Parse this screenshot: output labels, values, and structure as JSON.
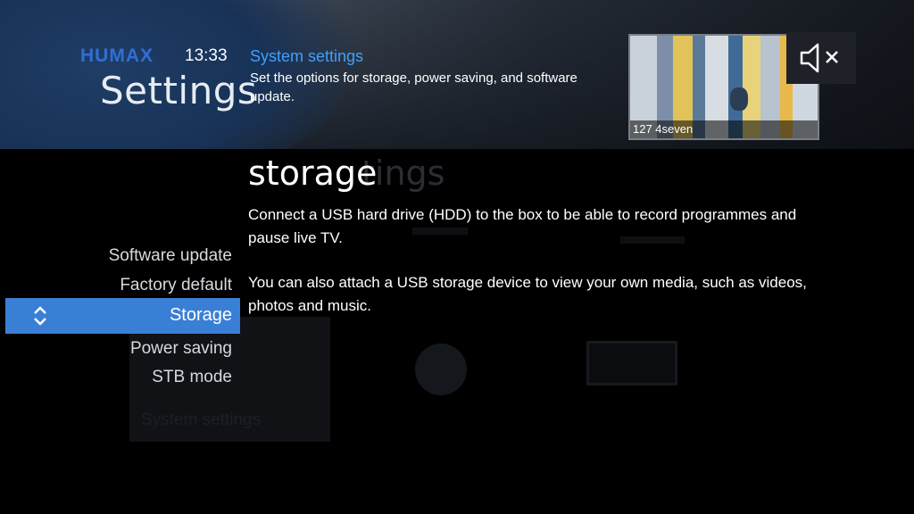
{
  "header": {
    "brand": "HUMAX",
    "time": "13:33",
    "page_title": "Settings",
    "section_title": "System settings",
    "section_description": "Set the options for storage, power saving, and software update."
  },
  "preview": {
    "channel_caption": "127 4seven"
  },
  "mute": {
    "icon": "speaker-muted-icon"
  },
  "menu": {
    "items": [
      {
        "label": "Software update",
        "selected": false
      },
      {
        "label": "Factory default",
        "selected": false
      },
      {
        "label": "Storage",
        "selected": true
      },
      {
        "label": "Power saving",
        "selected": false
      },
      {
        "label": "STB mode",
        "selected": false
      }
    ]
  },
  "content": {
    "heading": "storage",
    "ghost_heading": "tings",
    "paragraph_1": "Connect a USB hard drive (HDD) to the box to be able to record programmes and pause live TV.",
    "paragraph_2": "You can also attach a USB storage device to view your own media, such as videos, photos and music."
  },
  "background": {
    "ghost_label": "System settings"
  },
  "colors": {
    "accent": "#3a7fd6",
    "brand": "#2f6fd6",
    "section_title": "#3fa0ff"
  }
}
